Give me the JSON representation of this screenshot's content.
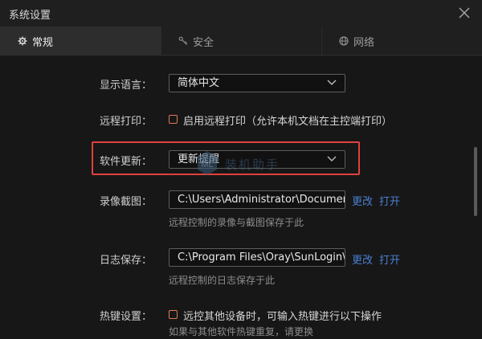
{
  "window": {
    "title": "系统设置"
  },
  "tabs": [
    {
      "label": "常规",
      "icon": "gear-icon",
      "active": true
    },
    {
      "label": "安全",
      "icon": "key-icon",
      "active": false
    },
    {
      "label": "网络",
      "icon": "globe-icon",
      "active": false
    }
  ],
  "settings": {
    "language": {
      "label": "显示语言：",
      "value": "简体中文"
    },
    "remote_print": {
      "label": "远程打印：",
      "checkbox_text": "启用远程打印（允许本机文档在主控端打印）",
      "checked": false
    },
    "software_update": {
      "label": "软件更新：",
      "value": "更新提醒"
    },
    "recording": {
      "label": "录像截图：",
      "path": "C:\\Users\\Administrator\\Documents",
      "change": "更改",
      "open": "打开",
      "hint": "远程控制的录像与截图保存于此"
    },
    "log": {
      "label": "日志保存：",
      "path": "C:\\Program Files\\Oray\\SunLogin\\SunloginClient\\log",
      "change": "更改",
      "open": "打开",
      "hint": "远程控制的日志保存于此"
    },
    "hotkey": {
      "label": "热键设置：",
      "checkbox_text": "远控其他设备时，可输入热键进行以下操作",
      "checked": false,
      "hint": "如果与其他软件热键重复，请更换"
    }
  },
  "watermark": {
    "text": "装机助手"
  },
  "colors": {
    "accent_link": "#4a7fd1",
    "highlight": "#e0413e",
    "checkbox": "#e07b54"
  }
}
